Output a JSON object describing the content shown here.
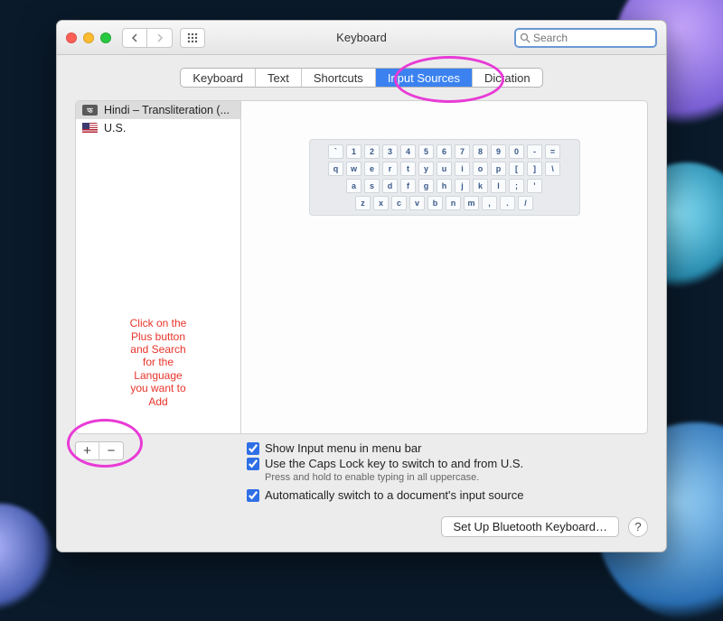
{
  "window": {
    "title": "Keyboard",
    "search_placeholder": "Search"
  },
  "tabs": [
    {
      "label": "Keyboard",
      "active": false
    },
    {
      "label": "Text",
      "active": false
    },
    {
      "label": "Shortcuts",
      "active": false
    },
    {
      "label": "Input Sources",
      "active": true
    },
    {
      "label": "Dictation",
      "active": false
    }
  ],
  "sidebar": {
    "items": [
      {
        "label": "Hindi – Transliteration (...",
        "selected": true,
        "icon": "hindi"
      },
      {
        "label": "U.S.",
        "selected": false,
        "icon": "us"
      }
    ]
  },
  "annotation_text": "Click on the\nPlus button\nand Search\nfor the\nLanguage\nyou want to\nAdd",
  "keyboard_rows": [
    [
      "`",
      "1",
      "2",
      "3",
      "4",
      "5",
      "6",
      "7",
      "8",
      "9",
      "0",
      "-",
      "="
    ],
    [
      "q",
      "w",
      "e",
      "r",
      "t",
      "y",
      "u",
      "i",
      "o",
      "p",
      "[",
      "]",
      "\\"
    ],
    [
      "a",
      "s",
      "d",
      "f",
      "g",
      "h",
      "j",
      "k",
      "l",
      ";",
      "'"
    ],
    [
      "z",
      "x",
      "c",
      "v",
      "b",
      "n",
      "m",
      ",",
      ".",
      "/"
    ]
  ],
  "addremove": {
    "plus": "+",
    "minus": "−"
  },
  "checkboxes": {
    "show_menu": {
      "label": "Show Input menu in menu bar",
      "checked": true
    },
    "caps_lock": {
      "label": "Use the Caps Lock key to switch to and from U.S.",
      "checked": true,
      "note": "Press and hold to enable typing in all uppercase."
    },
    "auto_switch": {
      "label": "Automatically switch to a document's input source",
      "checked": true
    }
  },
  "footer": {
    "bluetooth": "Set Up Bluetooth Keyboard…",
    "help": "?"
  }
}
